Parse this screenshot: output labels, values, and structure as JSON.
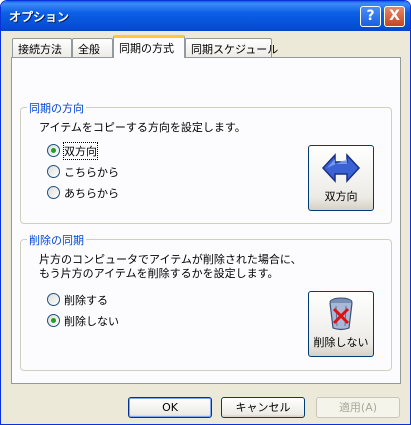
{
  "window": {
    "title": "オプション",
    "help_label": "?",
    "close_label": "X"
  },
  "tabs": [
    {
      "label": "接続方法"
    },
    {
      "label": "全般"
    },
    {
      "label": "同期の方式"
    },
    {
      "label": "同期スケジュール"
    }
  ],
  "sync_direction": {
    "title": "同期の方向",
    "description": "アイテムをコピーする方向を設定します。",
    "options": [
      {
        "label": "双方向",
        "checked": true
      },
      {
        "label": "こちらから",
        "checked": false
      },
      {
        "label": "あちらから",
        "checked": false
      }
    ],
    "button_label": "双方向",
    "button_icon": "double-arrow-icon"
  },
  "delete_sync": {
    "title": "削除の同期",
    "description_line1": "片方のコンピュータでアイテムが削除された場合に、",
    "description_line2": "もう片方のアイテムを削除するかを設定します。",
    "options": [
      {
        "label": "削除する",
        "checked": false
      },
      {
        "label": "削除しない",
        "checked": true
      }
    ],
    "button_label": "削除しない",
    "button_icon": "trash-no-delete-icon"
  },
  "footer": {
    "ok": "OK",
    "cancel": "キャンセル",
    "apply": "適用(A)"
  },
  "colors": {
    "titlebar": "#0553d9",
    "group_title": "#0046d5",
    "active_tab_accent": "#ffc83c"
  }
}
